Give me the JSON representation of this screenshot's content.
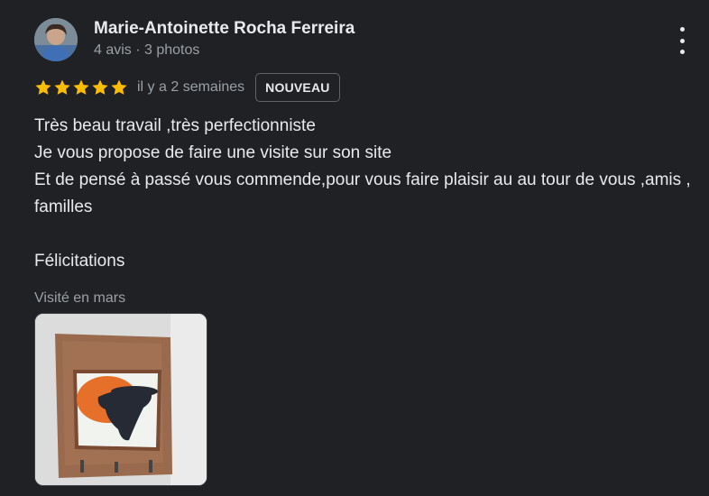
{
  "review": {
    "author_name": "Marie-Antoinette Rocha Ferreira",
    "author_meta": "4 avis · 3 photos",
    "rating": 5,
    "rating_max": 5,
    "time_ago": "il y a 2 semaines",
    "badge": "NOUVEAU",
    "text_lines": [
      "Très beau travail ,très perfectionniste",
      "Je vous propose de faire une visite sur son site",
      "Et de pensé à passé vous commende,pour vous faire plaisir au au tour de vous ,amis , familles",
      "",
      "Félicitations"
    ],
    "visited": "Visité en mars",
    "more_icon": "more-vert-icon",
    "star_color": "#fbbc04"
  }
}
